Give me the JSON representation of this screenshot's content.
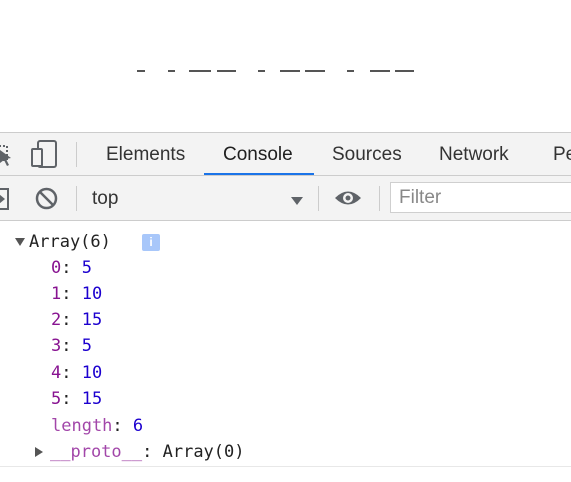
{
  "devtools": {
    "tabs": [
      {
        "label": "Elements"
      },
      {
        "label": "Console"
      },
      {
        "label": "Sources"
      },
      {
        "label": "Network"
      },
      {
        "label": "Pe"
      }
    ],
    "active_tab": "Console",
    "toolbar": {
      "context": "top",
      "filter_placeholder": "Filter"
    }
  },
  "console": {
    "array_label": "Array(6)",
    "info_badge": "i",
    "items": [
      {
        "key": "0",
        "value": "5"
      },
      {
        "key": "1",
        "value": "10"
      },
      {
        "key": "2",
        "value": "15"
      },
      {
        "key": "3",
        "value": "5"
      },
      {
        "key": "4",
        "value": "10"
      },
      {
        "key": "5",
        "value": "15"
      }
    ],
    "length_key": "length",
    "length_value": "6",
    "proto_key": "__proto__",
    "proto_value": "Array(0)"
  },
  "colors": {
    "accent": "#1a73e8",
    "key": "#881391",
    "number": "#1c00cf"
  }
}
